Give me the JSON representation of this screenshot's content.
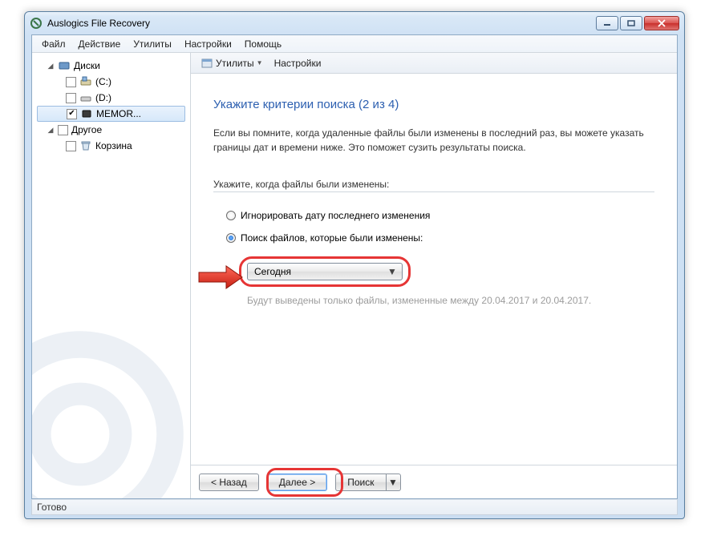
{
  "window": {
    "title": "Auslogics File Recovery"
  },
  "menubar": {
    "file": "Файл",
    "actions": "Действие",
    "utils": "Утилиты",
    "settings": "Настройки",
    "help": "Помощь"
  },
  "sidebar": {
    "disks_label": "Диски",
    "drive_c": "(C:)",
    "drive_d": "(D:)",
    "drive_mem": "MEMOR...",
    "other_label": "Другое",
    "recycle": "Корзина"
  },
  "toolbar": {
    "utils": "Утилиты",
    "settings": "Настройки"
  },
  "page": {
    "title": "Укажите критерии поиска (2 из 4)",
    "lead": "Если вы помните, когда удаленные файлы были изменены в последний раз, вы можете указать границы дат и времени ниже. Это поможет сузить результаты поиска.",
    "section_label": "Укажите, когда файлы были изменены:",
    "radio_ignore": "Игнорировать дату последнего изменения",
    "radio_search": "Поиск файлов, которые были изменены:",
    "combo_value": "Сегодня",
    "hint": "Будут выведены только файлы, измененные между 20.04.2017 и 20.04.2017."
  },
  "footer": {
    "back": "< Назад",
    "next": "Далее >",
    "search": "Поиск"
  },
  "status": {
    "text": "Готово"
  }
}
